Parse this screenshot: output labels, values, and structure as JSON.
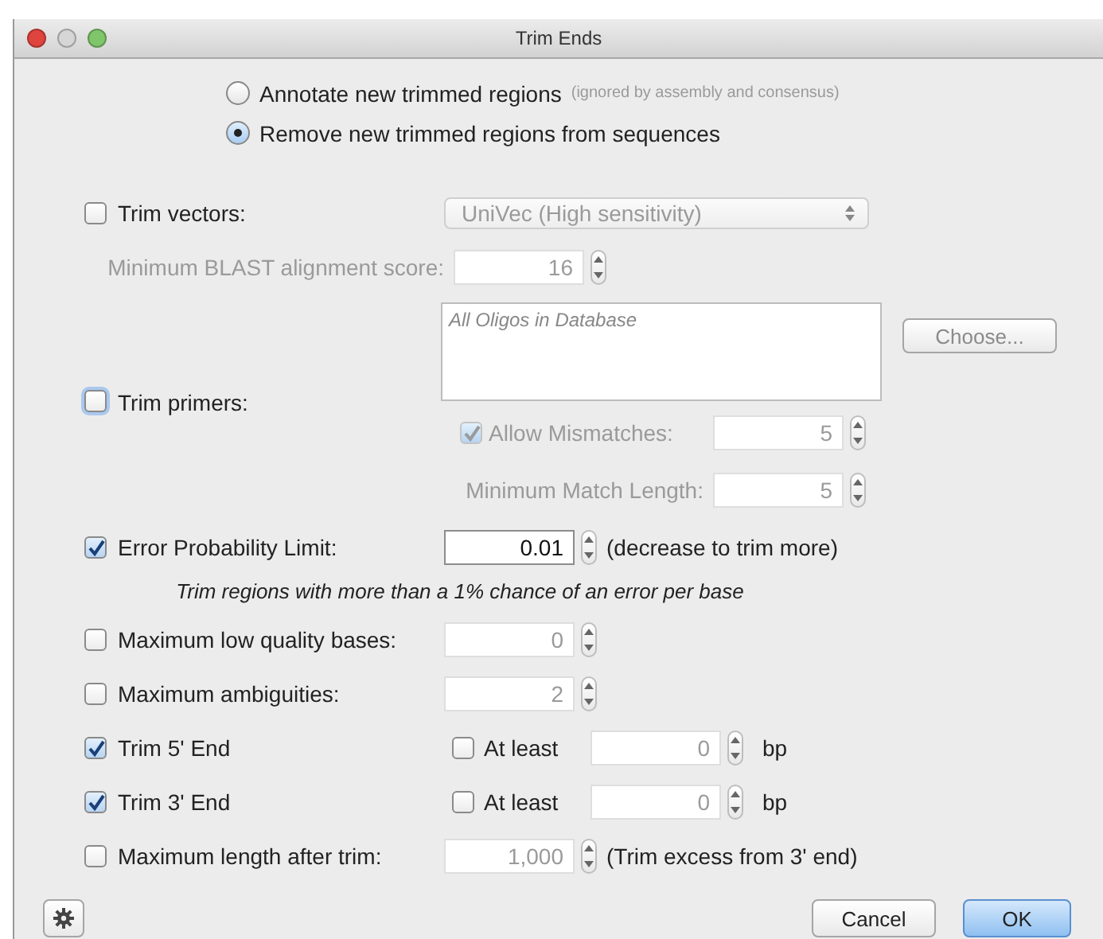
{
  "window": {
    "title": "Trim Ends"
  },
  "trim_mode": [
    {
      "label": "Annotate new trimmed regions",
      "hint": "(ignored by assembly and consensus)",
      "selected": false
    },
    {
      "label": "Remove new trimmed regions from sequences",
      "selected": true
    }
  ],
  "trim_vectors": {
    "label": "Trim vectors:",
    "checked": false,
    "database": "UniVec (High sensitivity)",
    "score_label": "Minimum BLAST alignment score:",
    "score": "16"
  },
  "trim_primers": {
    "label": "Trim primers:",
    "checked": false,
    "focused": true,
    "primer_list": "All Oligos in Database",
    "choose_button": "Choose...",
    "allow_mismatches": {
      "label": "Allow Mismatches:",
      "checked": true,
      "value": "5"
    },
    "min_match_label": "Minimum Match Length:",
    "min_match": "5"
  },
  "error_probability": {
    "label": "Error Probability Limit:",
    "checked": true,
    "value": "0.01",
    "note": "(decrease to trim more)",
    "explanation": "Trim regions with more than a 1% chance of an error per base"
  },
  "limits": [
    {
      "kind": "spin",
      "label": "Maximum low quality bases:",
      "checked": false,
      "value": "0"
    },
    {
      "kind": "spin",
      "label": "Maximum ambiguities:",
      "checked": false,
      "value": "2"
    },
    {
      "kind": "end",
      "label": "Trim 5' End",
      "checked": true,
      "at_least": {
        "label": "At least",
        "checked": false,
        "value": "0",
        "unit": "bp"
      }
    },
    {
      "kind": "end",
      "label": "Trim 3' End",
      "checked": true,
      "at_least": {
        "label": "At least",
        "checked": false,
        "value": "0",
        "unit": "bp"
      }
    },
    {
      "kind": "spin",
      "label": "Maximum length after trim:",
      "checked": false,
      "value": "1,000",
      "note": "(Trim excess from 3' end)"
    }
  ],
  "footer": {
    "buttons": [
      {
        "label": "Cancel",
        "default": false
      },
      {
        "label": "OK",
        "default": true
      }
    ]
  }
}
